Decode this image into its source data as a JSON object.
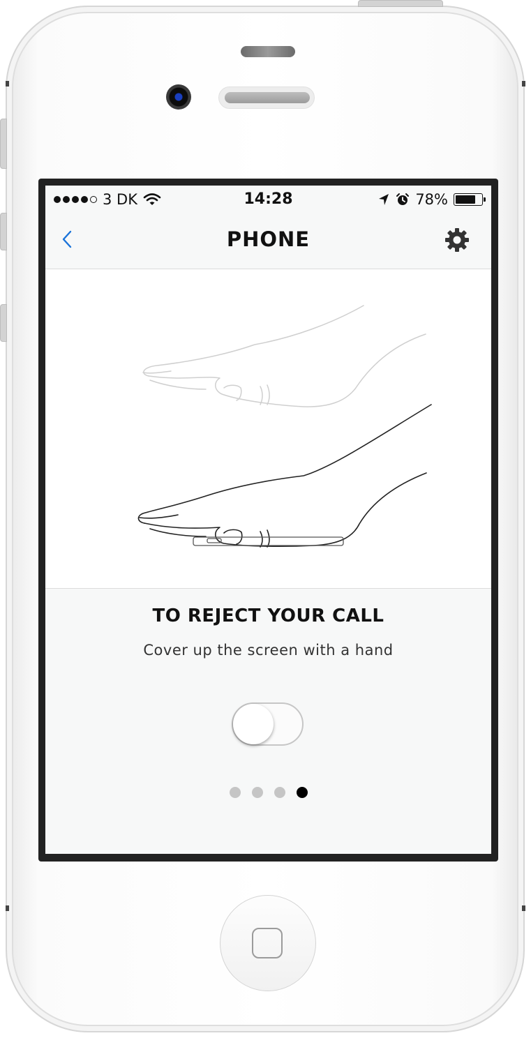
{
  "status_bar": {
    "signal_bars": 4,
    "signal_max": 5,
    "carrier": "3 DK",
    "time": "14:28",
    "battery_percent": "78%",
    "battery_level": 0.78,
    "icons": [
      "wifi-icon",
      "location-arrow-icon",
      "alarm-clock-icon",
      "battery-icon"
    ]
  },
  "nav": {
    "title": "PHONE",
    "back_icon": "chevron-left-icon",
    "settings_icon": "gear-icon",
    "accent_color": "#1a73d9"
  },
  "onboarding": {
    "illustration": "hand-over-phone-illustration",
    "headline": "TO REJECT YOUR CALL",
    "description": "Cover up the screen with a hand",
    "toggle_on": false,
    "page_count": 4,
    "current_page": 4
  }
}
